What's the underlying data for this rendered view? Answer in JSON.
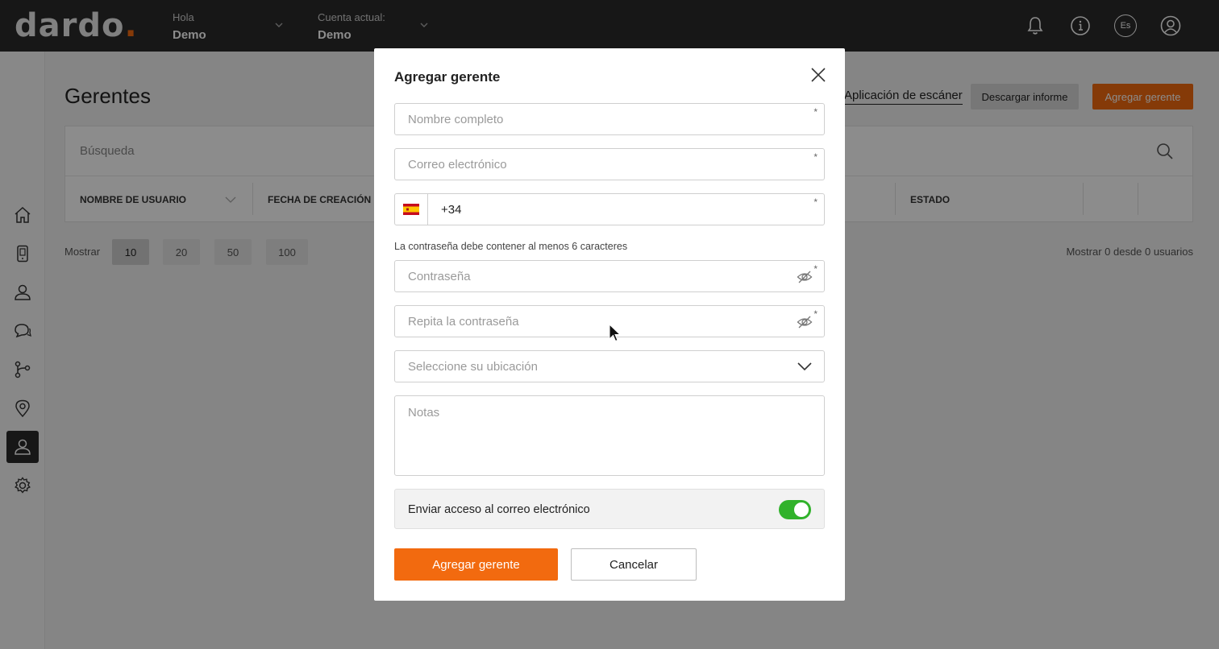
{
  "app": {
    "logo_text": "dardo",
    "logo_dot": "."
  },
  "topbar": {
    "greeting_label": "Hola",
    "greeting_user": "Demo",
    "account_label": "Cuenta actual:",
    "account_value": "Demo",
    "language_code": "Es"
  },
  "page": {
    "title": "Gerentes",
    "scanner_link": "Aplicación de escáner",
    "download_button": "Descargar informe",
    "add_button": "Agregar gerente",
    "search_placeholder": "Búsqueda",
    "columns": [
      "NOMBRE DE USUARIO",
      "FECHA DE CREACIÓN",
      "ESTADO"
    ],
    "show_label": "Mostrar",
    "page_sizes": [
      "10",
      "20",
      "50",
      "100"
    ],
    "selected_page_size": "10",
    "count_text": "Mostrar 0 desde 0 usuarios"
  },
  "sidebar": {
    "items": [
      {
        "icon": "home-icon"
      },
      {
        "icon": "device-icon"
      },
      {
        "icon": "users-icon"
      },
      {
        "icon": "chat-icon"
      },
      {
        "icon": "flow-icon"
      },
      {
        "icon": "location-icon"
      },
      {
        "icon": "manager-icon",
        "active": true
      },
      {
        "icon": "gear-icon"
      }
    ]
  },
  "modal": {
    "title": "Agregar gerente",
    "full_name_placeholder": "Nombre completo",
    "email_placeholder": "Correo electrónico",
    "phone_flag": "🇪🇸",
    "phone_value": "+34",
    "password_hint": "La contraseña debe contener al menos 6 caracteres",
    "password_placeholder": "Contraseña",
    "repeat_password_placeholder": "Repita la contraseña",
    "location_placeholder": "Seleccione su ubicación",
    "notes_placeholder": "Notas",
    "send_access_label": "Enviar acceso al correo electrónico",
    "send_access_enabled": true,
    "required_mark": "*",
    "submit_button": "Agregar gerente",
    "cancel_button": "Cancelar"
  },
  "colors": {
    "accent": "#f26a0f",
    "topbar": "#2b2b2b",
    "toggle_on": "#31b22b"
  }
}
